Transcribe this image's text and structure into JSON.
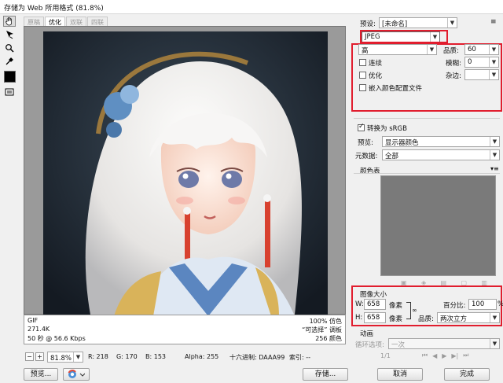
{
  "window": {
    "title": "存储为 Web 所用格式 (81.8%)"
  },
  "tabs": [
    "原稿",
    "优化",
    "双联",
    "四联"
  ],
  "active_tab_index": 1,
  "info": {
    "format": "GIF",
    "size": "271.4K",
    "time": "50 秒 @ 56.6 Kbps",
    "percent_line": "100% 仿色",
    "selective_line": "“可选择” 调板",
    "colors_line": "256 颜色"
  },
  "status": {
    "zoom": "81.8%",
    "r": "R: 218",
    "g": "G: 170",
    "b": "B: 153",
    "alpha": "Alpha: 255",
    "hex": "十六进制: DAAA99",
    "index": "索引: --"
  },
  "settings": {
    "preset_label": "预设:",
    "preset_value": "[未命名]",
    "format_value": "JPEG",
    "quality_level": "高",
    "quality_label": "品质:",
    "quality_value": "60",
    "progressive_label": "连续",
    "blur_label": "模糊:",
    "blur_value": "0",
    "optimized_label": "优化",
    "matte_label": "杂边:",
    "embed_profile_label": "嵌入颜色配置文件",
    "convert_srgb_label": "转换为 sRGB",
    "preview_label": "预览:",
    "preview_value": "显示器颜色",
    "metadata_label": "元数据:",
    "metadata_value": "全部",
    "color_table_label": "颜色表"
  },
  "image_size": {
    "title": "图像大小",
    "w_label": "W:",
    "w_value": "658",
    "h_label": "H:",
    "h_value": "658",
    "unit": "像素",
    "percent_label": "百分比:",
    "percent_value": "100",
    "percent_unit": "%",
    "quality_label": "品质:",
    "quality_value": "两次立方"
  },
  "animation": {
    "title": "动画",
    "loop_label": "循环选项:",
    "loop_value": "一次",
    "frame_counter": "1/1"
  },
  "buttons": {
    "preview": "预览...",
    "save": "存储...",
    "cancel": "取消",
    "done": "完成"
  },
  "colors": {
    "highlight": "#e11d2e",
    "preview_bg": "#9a9a9a",
    "color_table_bg": "#7a7a7a"
  }
}
